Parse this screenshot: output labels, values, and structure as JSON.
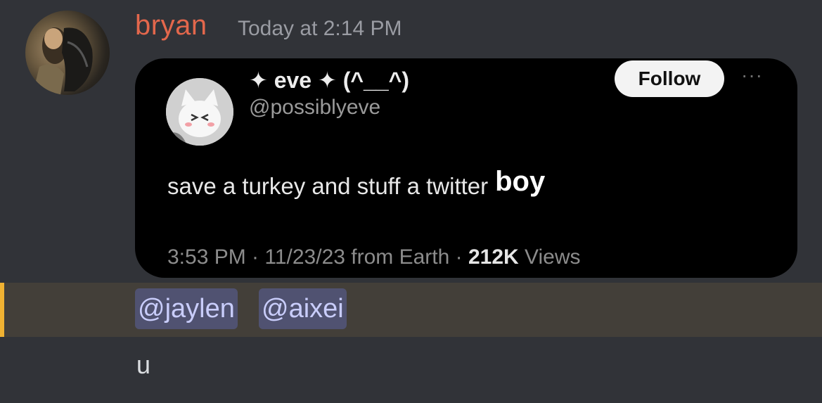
{
  "message": {
    "author": "bryan",
    "timestamp": "Today at 2:14 PM",
    "embed": {
      "display_name": "✦ eve ✦ (^__^)",
      "handle": "@possiblyeve",
      "follow_label": "Follow",
      "more_icon": "···",
      "text_main": "save a turkey and stuff a twitter",
      "text_emphasis": "boy",
      "meta_prefix": "3:53 PM · 11/23/23 from Earth · ",
      "views_count": "212K",
      "views_label": " Views"
    },
    "mentions": [
      "@jaylen",
      "@aixei"
    ],
    "followup_text": "u"
  },
  "colors": {
    "background": "#313338",
    "author": "#e3674c",
    "mention_highlight": "#433f39",
    "mention_bar": "#f0b232",
    "mention_pill": "#505271",
    "mention_text": "#c9cdfb"
  }
}
